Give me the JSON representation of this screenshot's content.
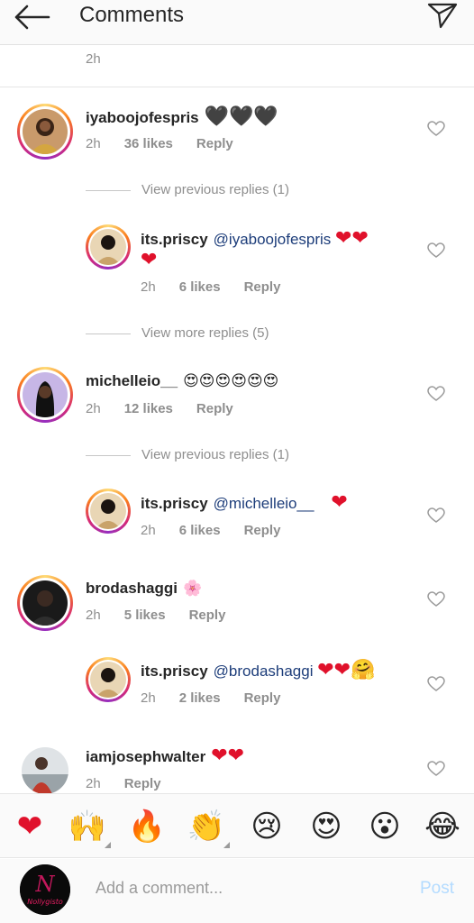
{
  "header": {
    "title": "Comments",
    "back_icon": "arrow-left-icon",
    "send_icon": "paper-plane-icon"
  },
  "top_time": "2h",
  "comments": [
    {
      "username": "iyaboojofespris",
      "text": "🖤🖤🖤",
      "time": "2h",
      "likes": "36 likes",
      "reply": "Reply"
    },
    {
      "username": "its.priscy",
      "mention": "@iyaboojofespris",
      "text": "❤❤",
      "text2": "❤",
      "time": "2h",
      "likes": "6 likes",
      "reply": "Reply"
    },
    {
      "username": "michelleio__",
      "text": "😍😍😍😍😍😍",
      "time": "2h",
      "likes": "12 likes",
      "reply": "Reply"
    },
    {
      "username": "its.priscy",
      "mention": "@michelleio__",
      "text": "❤",
      "time": "2h",
      "likes": "6 likes",
      "reply": "Reply"
    },
    {
      "username": "brodashaggi",
      "text": "🌸",
      "time": "2h",
      "likes": "5 likes",
      "reply": "Reply"
    },
    {
      "username": "its.priscy",
      "mention": "@brodashaggi",
      "text": "❤❤🤗",
      "time": "2h",
      "likes": "2 likes",
      "reply": "Reply"
    },
    {
      "username": "iamjosephwalter",
      "text": "❤❤",
      "time": "2h",
      "reply": "Reply"
    }
  ],
  "view_replies": {
    "first": "View previous replies (1)",
    "second": "View more replies (5)",
    "third": "View previous replies (1)"
  },
  "emoji_bar": [
    "❤",
    "🙌",
    "🔥",
    "👏",
    "😢",
    "😍",
    "😮",
    "😂"
  ],
  "compose": {
    "placeholder": "Add a comment...",
    "post": "Post",
    "avatar_logo_text": "Nollygisto"
  },
  "colors": {
    "heart": "#e0112b",
    "mention": "#1d3d7a",
    "meta": "#8e8e8e",
    "post_disabled": "#b3dbff"
  }
}
